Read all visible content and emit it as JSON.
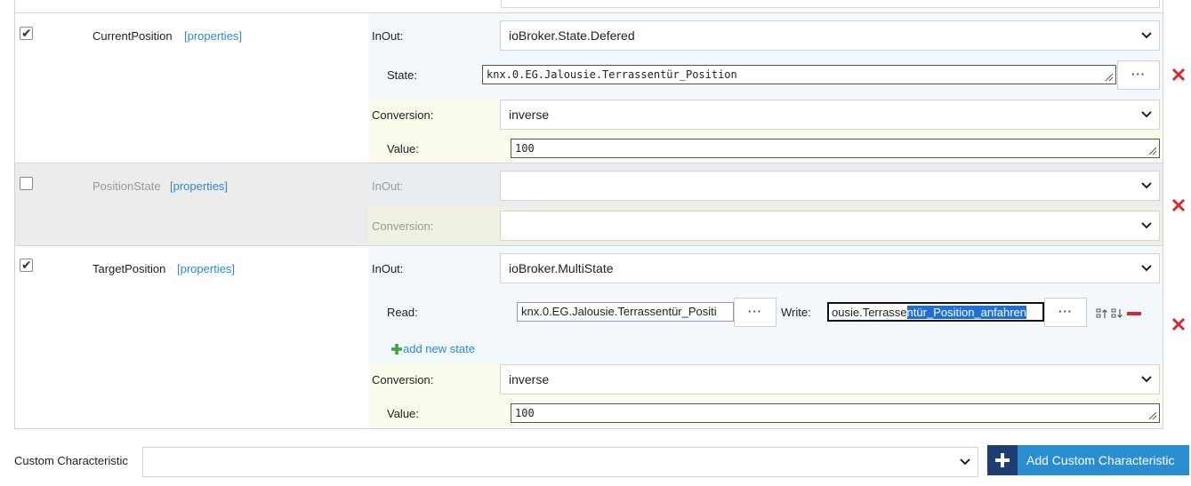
{
  "rows": [
    {
      "checked": true,
      "name": "CurrentPosition",
      "properties_link": "[properties]",
      "inout_label": "InOut:",
      "inout_value": "ioBroker.State.Defered",
      "state_label": "State:",
      "state_value": "knx.0.EG.Jalousie.Terrassentür_Position",
      "conversion_label": "Conversion:",
      "conversion_value": "inverse",
      "value_label": "Value:",
      "value_value": "100"
    },
    {
      "checked": false,
      "name": "PositionState",
      "properties_link": "[properties]",
      "inout_label": "InOut:",
      "inout_value": "",
      "conversion_label": "Conversion:",
      "conversion_value": ""
    },
    {
      "checked": true,
      "name": "TargetPosition",
      "properties_link": "[properties]",
      "inout_label": "InOut:",
      "inout_value": "ioBroker.MultiState",
      "read_label": "Read:",
      "read_value": "knx.0.EG.Jalousie.Terrassentür_Positi",
      "write_label": "Write:",
      "write_value_plain": "ousie.Terrasse",
      "write_value_selected": "ntür_Position_anfahren",
      "add_state_label": "add new state",
      "conversion_label": "Conversion:",
      "conversion_value": "inverse",
      "value_label": "Value:",
      "value_value": "100"
    }
  ],
  "browse_label": "···",
  "custom": {
    "label": "Custom Characteristic",
    "select_value": "",
    "add_button_label": "Add Custom Characteristic"
  },
  "colors": {
    "accent": "#2a8dd2",
    "accent_dark": "#1e3d73",
    "delete_red": "#d9272e",
    "add_green": "#3aa53a",
    "link_blue": "#2a8ad4",
    "row_disabled_bg": "#ececec",
    "inout_panel_bg": "#f3f8fd",
    "conversion_panel_bg": "#fafbec"
  }
}
